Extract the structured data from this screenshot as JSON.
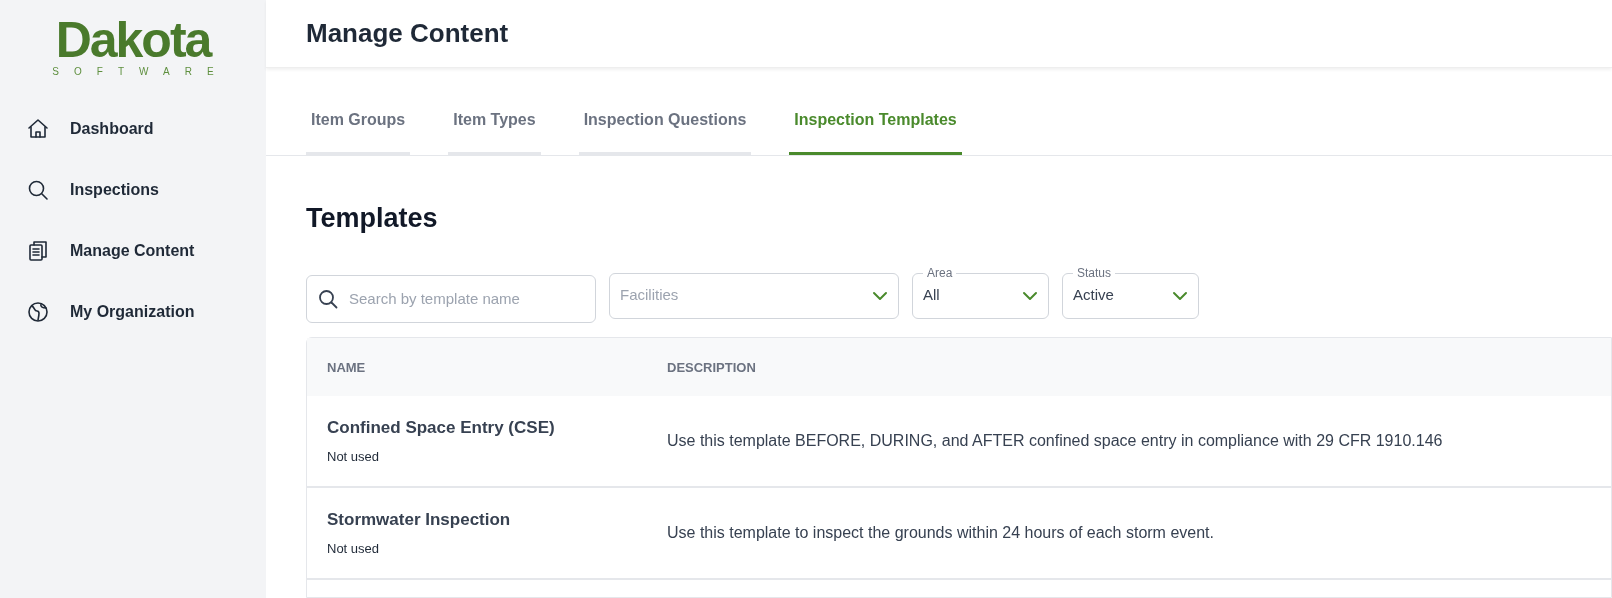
{
  "logo": {
    "name": "Dakota",
    "tagline": "SOFTWARE"
  },
  "sidebar": {
    "items": [
      {
        "label": "Dashboard",
        "selected": false
      },
      {
        "label": "Inspections",
        "selected": false
      },
      {
        "label": "Manage Content",
        "selected": false
      },
      {
        "label": "My Organization",
        "selected": false
      }
    ]
  },
  "header": {
    "title": "Manage Content"
  },
  "tabs": [
    {
      "label": "Item Groups",
      "selected": false
    },
    {
      "label": "Item Types",
      "selected": false
    },
    {
      "label": "Inspection Questions",
      "selected": false
    },
    {
      "label": "Inspection Templates",
      "selected": true
    }
  ],
  "section_title": "Templates",
  "filters": [
    {
      "kind": "search",
      "placeholder": "Search by template name"
    },
    {
      "kind": "select",
      "placeholder": "Facilities"
    },
    {
      "kind": "select",
      "label": "Area",
      "value": "All"
    },
    {
      "kind": "select",
      "label": "Status",
      "value": "Active"
    }
  ],
  "table": {
    "columns": [
      "NAME",
      "DESCRIPTION"
    ],
    "rows": [
      {
        "name": "Confined Space Entry (CSE)",
        "usage": "Not used",
        "description": "Use this template BEFORE, DURING, and AFTER confined space entry in compliance with 29 CFR 1910.146"
      },
      {
        "name": "Stormwater Inspection",
        "usage": "Not used",
        "description": "Use this template to inspect the grounds within 24 hours of each storm event."
      }
    ]
  }
}
